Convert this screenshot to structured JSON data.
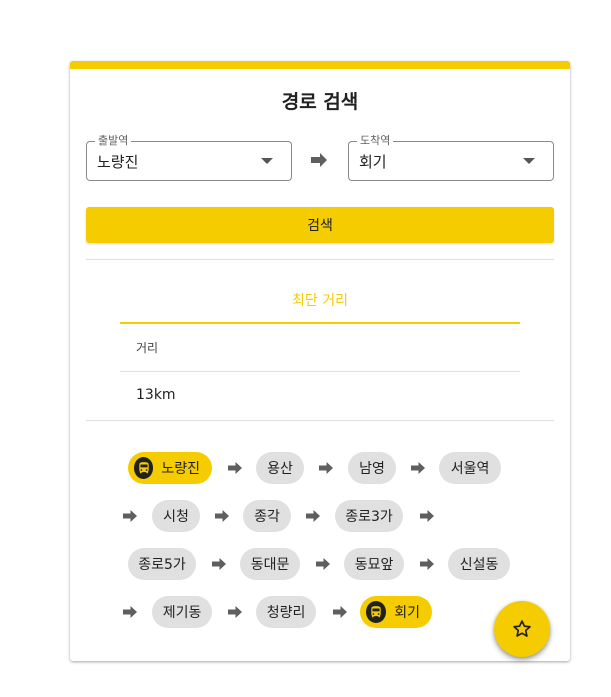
{
  "header": {
    "title": "경로 검색"
  },
  "search": {
    "from_legend": "출발역",
    "from_value": "노량진",
    "to_legend": "도착역",
    "to_value": "회기",
    "button_label": "검색"
  },
  "result": {
    "tab_label": "최단 거리",
    "column_header": "거리",
    "distance_value": "13km"
  },
  "route": {
    "stations": [
      "노량진",
      "용산",
      "남영",
      "서울역",
      "시청",
      "종각",
      "종로3가",
      "종로5가",
      "동대문",
      "동묘앞",
      "신설동",
      "제기동",
      "청량리",
      "회기"
    ]
  },
  "colors": {
    "accent": "#f5cc00",
    "chip": "#e0e0e0",
    "arrow": "#5f5f5f"
  },
  "icons": {
    "swap": "arrow-right-icon",
    "route_arrow": "arrow-right-icon",
    "endpoint": "bus-icon",
    "fab": "star-outline-icon",
    "dropdown": "caret-down-icon"
  }
}
